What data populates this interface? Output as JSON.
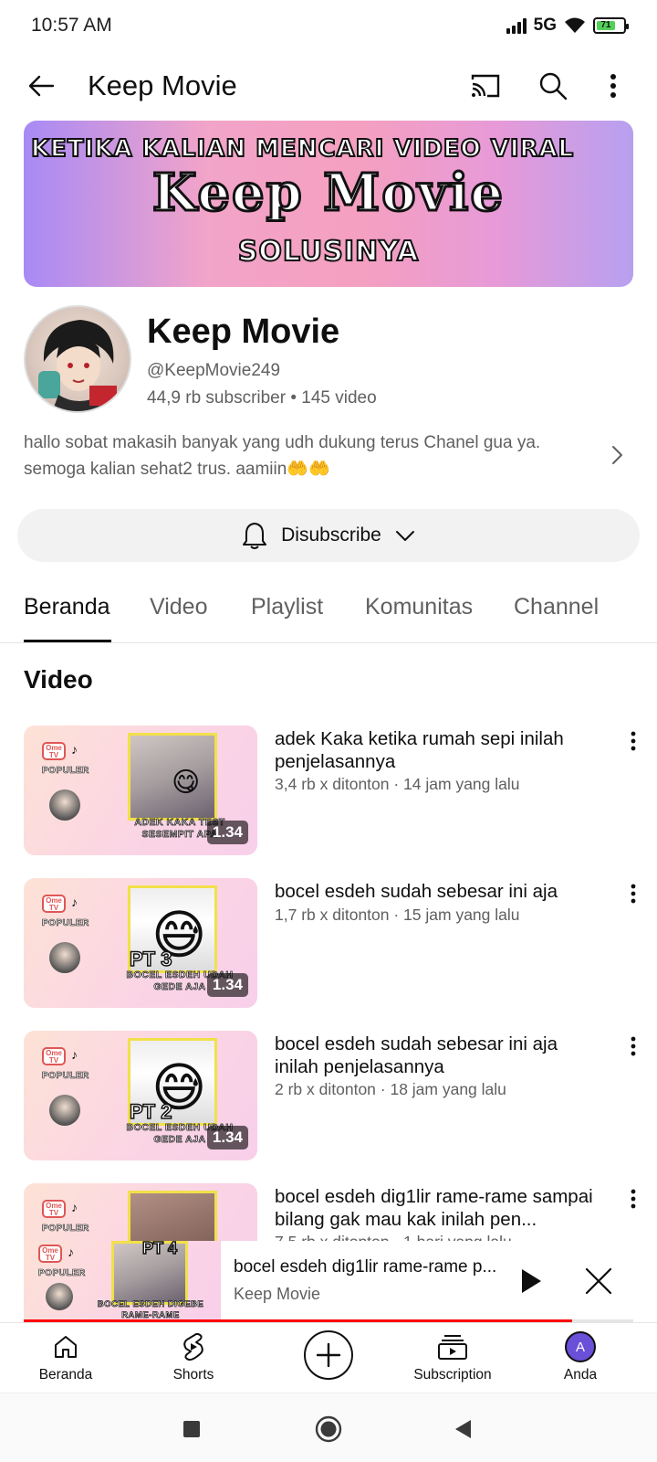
{
  "status_bar": {
    "time": "10:57 AM",
    "network": "5G",
    "battery": "71"
  },
  "app_bar": {
    "title": "Keep Movie"
  },
  "banner": {
    "line1": "KETIKA KALIAN MENCARI VIDEO VIRAL",
    "line2": "Keep Movie",
    "line3": "SOLUSINYA"
  },
  "channel": {
    "name": "Keep Movie",
    "handle": "@KeepMovie249",
    "stats": "44,9 rb subscriber • 145 video",
    "description": "hallo sobat makasih banyak yang udh dukung terus Chanel gua ya. semoga kalian sehat2 trus. aamiin🤲🤲"
  },
  "subscribe": {
    "label": "Disubscribe"
  },
  "tabs": [
    {
      "label": "Beranda",
      "active": true
    },
    {
      "label": "Video",
      "active": false
    },
    {
      "label": "Playlist",
      "active": false
    },
    {
      "label": "Komunitas",
      "active": false
    },
    {
      "label": "Channel",
      "active": false
    }
  ],
  "section": {
    "title": "Video"
  },
  "thumb_common": {
    "ome": "Ome TV",
    "tiktok": "TikTok",
    "populer": "POPULER"
  },
  "videos": [
    {
      "title": "adek Kaka ketika rumah sepi inilah penjelasannya",
      "meta": "3,4 rb x ditonton · 14 jam yang lalu",
      "duration": "1.34",
      "caption": "ADEK KAKA TEST SESEMPIT APA",
      "pt": "",
      "emoji": "😋"
    },
    {
      "title": "bocel esdeh sudah sebesar ini aja",
      "meta": "1,7 rb x ditonton · 15 jam yang lalu",
      "duration": "1.34",
      "caption": "BOCEL ESDEH UDAH GEDE AJA",
      "pt": "PT 3",
      "emoji": "😅"
    },
    {
      "title": "bocel esdeh sudah sebesar ini aja inilah penjelasannya",
      "meta": "2 rb x ditonton · 18 jam yang lalu",
      "duration": "1.34",
      "caption": "BOCEL ESDEH UDAH GEDE AJA",
      "pt": "PT 2",
      "emoji": "😅"
    },
    {
      "title": "bocel esdeh dig1lir rame-rame sampai bilang gak mau kak inilah pen...",
      "meta": "7,5 rb x ditonton · 1 hari yang lalu"
    }
  ],
  "mini_player": {
    "title": "bocel esdeh dig1lir rame-rame p...",
    "channel": "Keep Movie",
    "thumb_pt": "PT 4",
    "thumb_caption": "BOCEL ESDEH DIGEBE RAME-RAME",
    "progress": 0.9
  },
  "bottom_nav": [
    {
      "label": "Beranda",
      "icon": "home-icon"
    },
    {
      "label": "Shorts",
      "icon": "shorts-icon"
    },
    {
      "label": "",
      "icon": "create-icon"
    },
    {
      "label": "Subscription",
      "icon": "subscriptions-icon"
    },
    {
      "label": "Anda",
      "icon": "avatar",
      "initial": "A"
    }
  ],
  "colors": {
    "accent": "#ff0000",
    "text": "#0f0f0f",
    "secondary": "#606060",
    "button_bg": "#f2f2f2",
    "avatar": "#6a4fd8"
  }
}
